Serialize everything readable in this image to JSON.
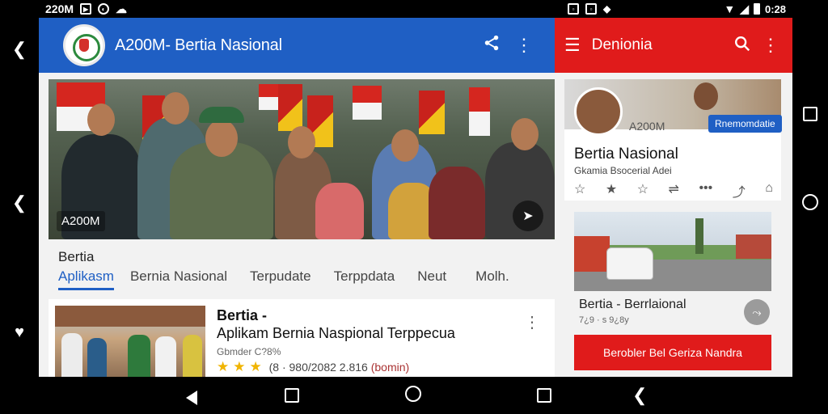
{
  "status_left": {
    "time": "220M"
  },
  "status_right": {
    "time": "0:28"
  },
  "left_app": {
    "title": "A200M- Bertia Nasional",
    "hero": {
      "badge": "A200M"
    },
    "section_label": "Bertia",
    "tabs": [
      {
        "label": "Aplikasm",
        "active": true
      },
      {
        "label": "Bernia Nasional"
      },
      {
        "label": "Terpudate"
      },
      {
        "label": "Terppdata"
      },
      {
        "label": "Neut"
      },
      {
        "label": "Molh."
      }
    ],
    "article": {
      "title": "Bertia -",
      "subtitle": "Aplikam Bernia Naspional Terppecua",
      "meta": "Gbmder C?8%",
      "rating_stars": "★★★",
      "rating_text": "(8 · 980/2082 2.816",
      "rating_extra": "(bomin)"
    }
  },
  "right_app": {
    "title": "Denionia",
    "profile": {
      "handle": "A200M",
      "badge": "Rnemomdatie",
      "name": "Bertia Nasional",
      "subtitle": "Gkamia  Bsocerial Adei"
    },
    "caption": "Bertia - Berrlaional",
    "caption_meta": "7¿9 · s  9¿8y",
    "cta_label": "Berobler Bel Geriza Nandra"
  },
  "icons": {
    "share": "share-icon",
    "more": "more-vert-icon",
    "menu": "menu-icon",
    "search": "search-icon",
    "play": "play-icon",
    "heart": "heart-icon"
  },
  "colors": {
    "left_toolbar": "#1f5fc4",
    "right_toolbar": "#e01b1b",
    "active_tab": "#1f5fc4",
    "stars": "#f0b400"
  }
}
